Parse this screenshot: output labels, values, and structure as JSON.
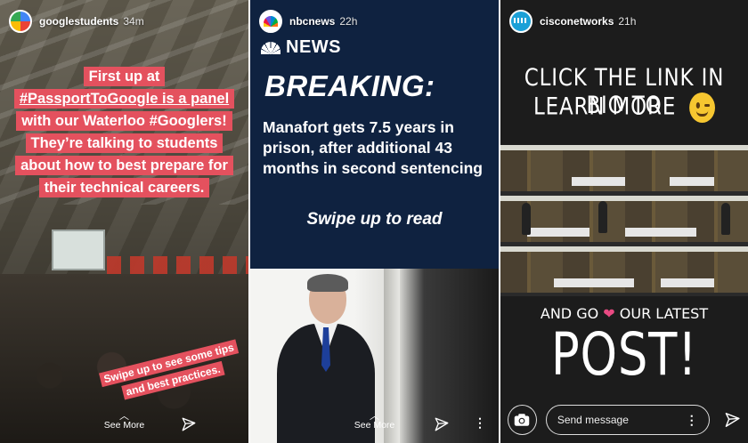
{
  "stories": [
    {
      "username": "googlestudents",
      "time": "34m",
      "caption_lines": [
        "First up at",
        "#PassportToGoogle is a panel",
        "with our Waterloo #Googlers!",
        "They’re talking to students",
        "about how to best prepare for",
        "their technical careers."
      ],
      "sticker_lines": [
        "Swipe up to see some tips",
        "and best practices."
      ],
      "see_more": "See More",
      "icons": {
        "send": "paper-plane-icon"
      }
    },
    {
      "username": "nbcnews",
      "time": "22h",
      "brand": "NEWS",
      "breaking": "BREAKING:",
      "headline": "Manafort gets 7.5 years in prison, after additional 43 months in second sentencing",
      "swipe": "Swipe up to read",
      "see_more": "See More",
      "icons": {
        "send": "paper-plane-icon",
        "more": "more-vertical-icon"
      }
    },
    {
      "username": "cisconetworks",
      "time": "21h",
      "line1": "CLICK THE LINK IN BIO TO",
      "line2": "LEARN MORE",
      "and_go_pre": "AND GO",
      "and_go_post": "OUR LATEST",
      "post": "POST!",
      "message_placeholder": "Send message",
      "icons": {
        "camera": "camera-icon",
        "more": "more-vertical-icon",
        "send": "paper-plane-icon"
      }
    }
  ],
  "colors": {
    "highlight": "#e4515e",
    "nbc_background": "#0f2240",
    "heart": "#e94a82",
    "smiley": "#f6c630"
  }
}
